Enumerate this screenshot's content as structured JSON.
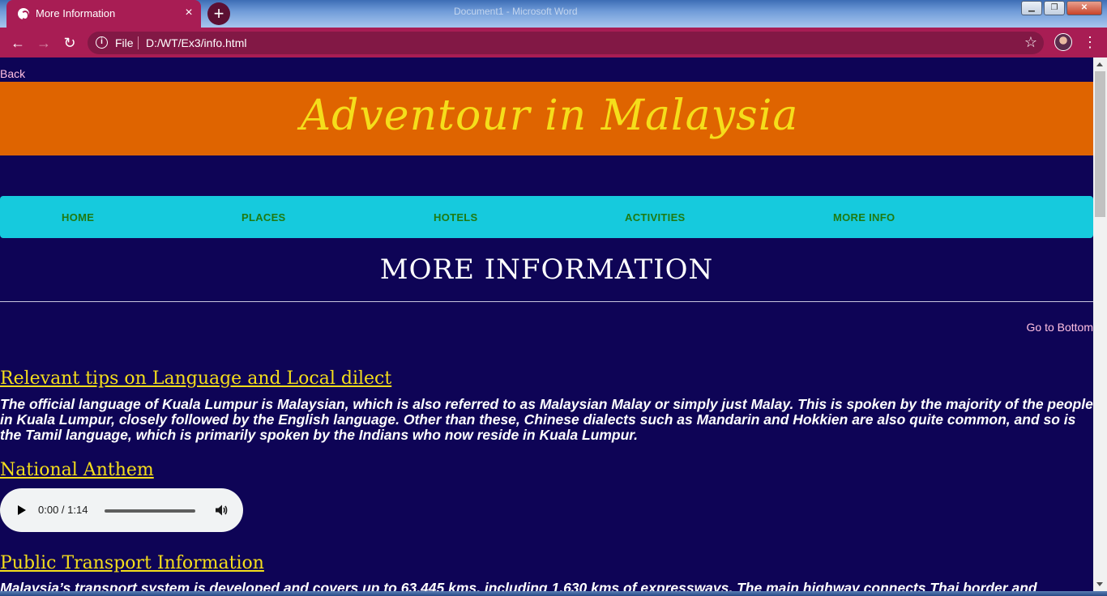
{
  "browser": {
    "tab_title": "More Information",
    "tab_close": "×",
    "new_tab": "+",
    "window_title": "Document1 - Microsoft Word",
    "scheme_label": "File",
    "url": "D:/WT/Ex3/info.html",
    "icons": {
      "back": "back-arrow-icon",
      "forward": "forward-arrow-icon",
      "reload": "reload-icon",
      "info": "info-icon",
      "star": "star-icon",
      "menu": "kebab-menu-icon"
    },
    "colors": {
      "frame": "#a81d54",
      "omnibox": "#821845"
    }
  },
  "page": {
    "back_link": "Back",
    "banner_title": "Adventour in Malaysia",
    "nav": [
      "HOME",
      "PLACES",
      "HOTELS",
      "ACTIVITIES",
      "MORE INFO"
    ],
    "heading": "MORE INFORMATION",
    "goto_bottom": "Go to Bottom",
    "sections": [
      {
        "heading": "Relevant tips on Language and Local dilect",
        "text": "The official language of Kuala Lumpur is Malaysian, which is also referred to as Malaysian Malay or simply just Malay. This is spoken by the majority of the people in Kuala Lumpur, closely followed by the English language. Other than these, Chinese dialects such as Mandarin and Hokkien are also quite common, and so is the Tamil language, which is primarily spoken by the Indians who now reside in Kuala Lumpur."
      },
      {
        "heading": "National Anthem"
      },
      {
        "heading": "Public Transport Information",
        "text": "Malaysia’s transport system is developed and covers up to 63,445 kms, including 1,630 kms of expressways. The main highway connects Thai border and"
      }
    ],
    "audio": {
      "time": "0:00 / 1:14",
      "progress": 0
    },
    "colors": {
      "background": "#0e0456",
      "banner": "#df6400",
      "banner_text": "#f5de1b",
      "navbar": "#16cadd",
      "nav_text": "#1f7a12",
      "link": "#ffc0e1"
    }
  }
}
